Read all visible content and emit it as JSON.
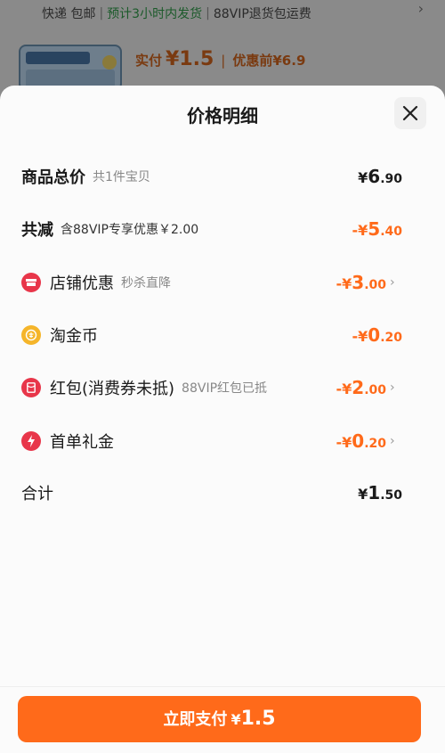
{
  "background": {
    "shipping": "快递 包邮",
    "ship_time": "预计3小时内发货",
    "return_note": "88VIP退货包运费",
    "paid_label": "实付",
    "paid_amount": "¥1.5",
    "before_label": "优惠前",
    "before_amount": "¥6.9"
  },
  "sheet": {
    "title": "价格明细",
    "rows": [
      {
        "label": "商品总价",
        "note": "共1件宝贝",
        "cur": "¥",
        "int": "6",
        "dec": ".90",
        "icon": ""
      },
      {
        "label": "共减",
        "note": "含88VIP专享优惠￥2.00",
        "cur": "-¥",
        "int": "5",
        "dec": ".40",
        "icon": ""
      },
      {
        "label": "店铺优惠",
        "note": "秒杀直降",
        "cur": "-¥",
        "int": "3",
        "dec": ".00",
        "icon": "store-coupon-icon"
      },
      {
        "label": "淘金币",
        "note": "",
        "cur": "-¥",
        "int": "0",
        "dec": ".20",
        "icon": "gold-coin-icon"
      },
      {
        "label": "红包(消费券未抵)",
        "note": "88VIP红包已抵",
        "cur": "-¥",
        "int": "2",
        "dec": ".00",
        "icon": "red-packet-icon"
      },
      {
        "label": "首单礼金",
        "note": "",
        "cur": "-¥",
        "int": "0",
        "dec": ".20",
        "icon": "lightning-icon"
      },
      {
        "label": "合计",
        "note": "",
        "cur": "¥",
        "int": "1",
        "dec": ".50",
        "icon": ""
      }
    ],
    "pay_button": {
      "label": "立即支付",
      "cur": "¥",
      "amount": "1.5"
    }
  },
  "colors": {
    "accent": "#ff6a1a",
    "red_icon": "#e8364a",
    "coin_icon": "#f5b52a"
  }
}
